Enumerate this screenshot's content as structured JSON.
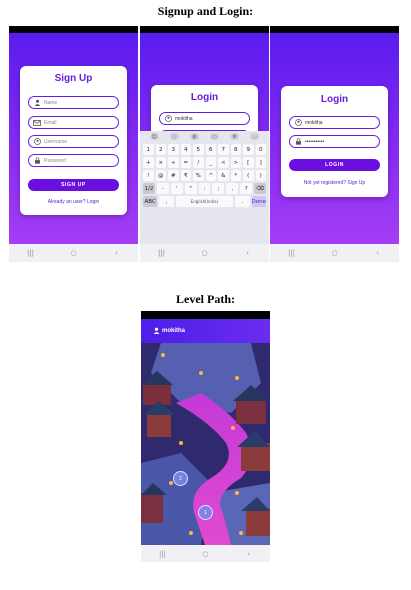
{
  "sections": {
    "signup_login_title": "Signup and Login:",
    "level_path_title": "Level Path:"
  },
  "signup": {
    "title": "Sign Up",
    "name_placeholder": "Name",
    "email_placeholder": "Email",
    "username_placeholder": "Username",
    "password_placeholder": "Password",
    "button": "SIGN UP",
    "link": "Already an user? Login"
  },
  "login": {
    "title": "Login",
    "username_value": "mokitha",
    "password_value": "•••••••••••",
    "button": "LOGIN",
    "link": "Not yet registered? Sign Up"
  },
  "keyboard": {
    "row1": [
      "1",
      "2",
      "3",
      "4",
      "5",
      "6",
      "7",
      "8",
      "9",
      "0"
    ],
    "row2": [
      "+",
      "×",
      "÷",
      "=",
      "/",
      "_",
      "<",
      ">",
      "[",
      "]"
    ],
    "row3": [
      "!",
      "@",
      "#",
      "₹",
      "%",
      "^",
      "&",
      "*",
      "(",
      ")"
    ],
    "row4": [
      "1/2",
      "-",
      "'",
      "\"",
      ":",
      ";",
      ",",
      "?",
      "⌫"
    ],
    "row5": [
      "ABC",
      ",",
      "English(India)",
      ".",
      "Done"
    ]
  },
  "level_path": {
    "username": "mokitha",
    "levels": [
      "2",
      "1"
    ]
  },
  "colors": {
    "brand_purple": "#6a1be0",
    "gradient_top": "#5a1cf0",
    "gradient_bottom": "#a43ef5"
  },
  "icons": {
    "nav_recent": "|||",
    "nav_home": "○",
    "nav_back": "‹"
  }
}
